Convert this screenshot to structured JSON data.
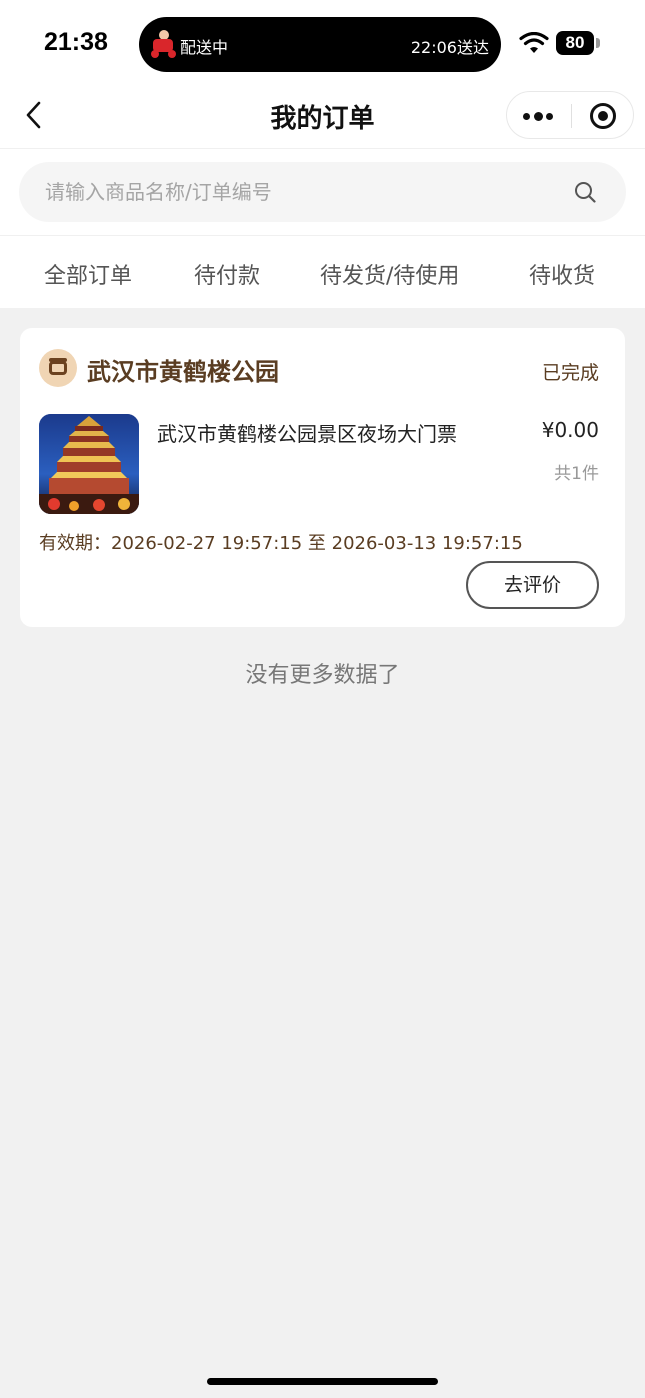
{
  "status_bar": {
    "time": "21:38",
    "activity_left": "配送中",
    "activity_right": "22:06送达",
    "battery": "80"
  },
  "nav": {
    "title": "我的订单"
  },
  "search": {
    "placeholder": "请输入商品名称/订单编号"
  },
  "tabs": [
    "全部订单",
    "待付款",
    "待发货/待使用",
    "待收货"
  ],
  "order": {
    "shop_name": "武汉市黄鹤楼公园",
    "status": "已完成",
    "product_title": "武汉市黄鹤楼公园景区夜场大门票",
    "price": "¥0.00",
    "quantity": "共1件",
    "validity": "有效期：2026-02-27 19:57:15 至 2026-03-13 19:57:15",
    "action_label": "去评价"
  },
  "footer_text": "没有更多数据了",
  "colors": {
    "accent_brown": "#5a3d22",
    "background": "#f1f1f1"
  }
}
